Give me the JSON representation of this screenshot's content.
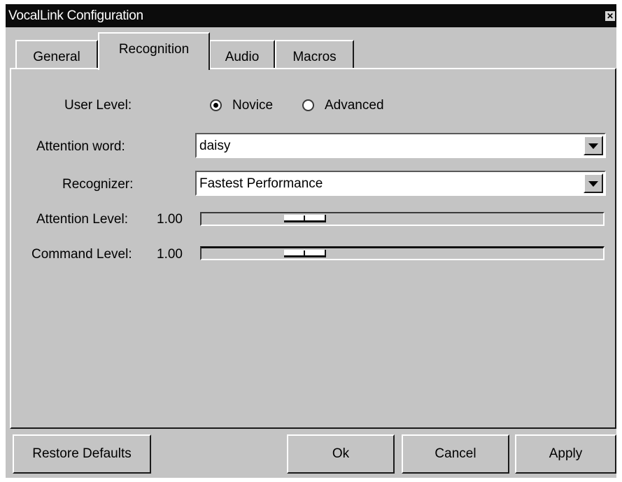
{
  "window": {
    "title": "VocalLink Configuration"
  },
  "tabs": [
    "General",
    "Recognition",
    "Audio",
    "Macros"
  ],
  "active_tab": "Recognition",
  "user_level": {
    "label": "User Level:",
    "options": [
      "Novice",
      "Advanced"
    ],
    "selected": "Novice"
  },
  "attention_word": {
    "label": "Attention word:",
    "value": "daisy"
  },
  "recognizer": {
    "label": "Recognizer:",
    "value": "Fastest Performance"
  },
  "attention_level": {
    "label": "Attention Level:",
    "value": "1.00",
    "slider_fraction": 0.23
  },
  "command_level": {
    "label": "Command Level:",
    "value": "1.00",
    "slider_fraction": 0.23
  },
  "buttons": {
    "restore_defaults": "Restore Defaults",
    "ok": "Ok",
    "cancel": "Cancel",
    "apply": "Apply"
  }
}
